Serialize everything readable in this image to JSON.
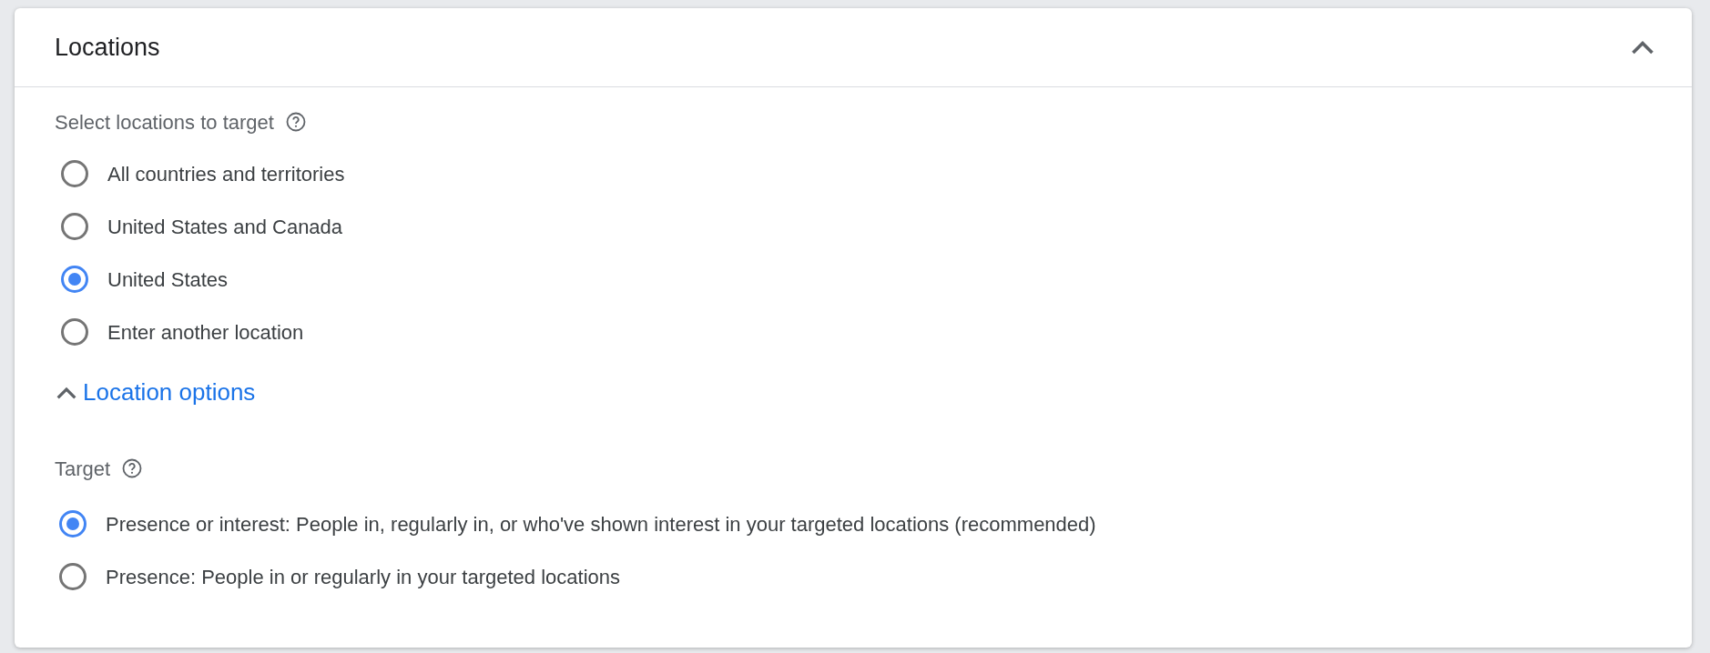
{
  "panel": {
    "title": "Locations",
    "expanded": true
  },
  "location_section": {
    "label": "Select locations to target",
    "options": [
      {
        "label": "All countries and territories",
        "selected": false
      },
      {
        "label": "United States and Canada",
        "selected": false
      },
      {
        "label": "United States",
        "selected": true
      },
      {
        "label": "Enter another location",
        "selected": false
      }
    ]
  },
  "location_options": {
    "label": "Location options",
    "expanded": true
  },
  "target_section": {
    "label": "Target",
    "options": [
      {
        "label": "Presence or interest: People in, regularly in, or who've shown interest in your targeted locations (recommended)",
        "selected": true
      },
      {
        "label": "Presence: People in or regularly in your targeted locations",
        "selected": false
      }
    ]
  }
}
